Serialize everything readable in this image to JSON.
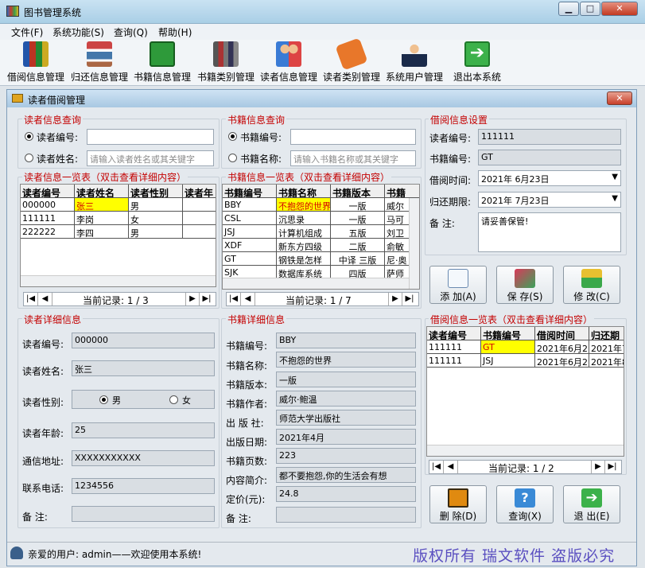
{
  "window": {
    "title": "图书管理系统",
    "min": "▁",
    "max": "□",
    "close": "✕"
  },
  "menu": [
    "文件(F)",
    "系统功能(S)",
    "查询(Q)",
    "帮助(H)"
  ],
  "toolbar": [
    {
      "label": "借阅信息管理",
      "icon": "books-icon"
    },
    {
      "label": "归还信息管理",
      "icon": "bookshelf-icon"
    },
    {
      "label": "书籍信息管理",
      "icon": "green-book-icon"
    },
    {
      "label": "书籍类别管理",
      "icon": "book-stack-icon"
    },
    {
      "label": "读者信息管理",
      "icon": "people-icon"
    },
    {
      "label": "读者类别管理",
      "icon": "orange-book-icon"
    },
    {
      "label": "系统用户管理",
      "icon": "user-icon"
    },
    {
      "label": "退出本系统",
      "icon": "exit-arrow-icon"
    }
  ],
  "subwindow": {
    "title": "读者借阅管理",
    "close": "✕"
  },
  "reader_query": {
    "legend": "读者信息查询",
    "opt_id": "读者编号:",
    "opt_name": "读者姓名:",
    "name_placeholder": "请输入读者姓名或其关键字"
  },
  "book_query": {
    "legend": "书籍信息查询",
    "opt_id": "书籍编号:",
    "opt_name": "书籍名称:",
    "name_placeholder": "请输入书籍名称或其关键字"
  },
  "borrow_settings": {
    "legend": "借阅信息设置",
    "reader_id_label": "读者编号:",
    "reader_id": "111111",
    "book_id_label": "书籍编号:",
    "book_id": "GT",
    "borrow_time_label": "借阅时间:",
    "borrow_time": "2021年 6月23日",
    "return_label": "归还期限:",
    "return_time": "2021年 7月23日",
    "note_label": "备    注:",
    "note": "请妥善保管!"
  },
  "reader_list": {
    "legend": "读者信息一览表（双击查看详细内容）",
    "columns": [
      "读者编号",
      "读者姓名",
      "读者性别",
      "读者年"
    ],
    "rows": [
      [
        "000000",
        "张三",
        "男",
        ""
      ],
      [
        "111111",
        "李岗",
        "女",
        ""
      ],
      [
        "222222",
        "李四",
        "男",
        ""
      ]
    ],
    "record": "当前记录: 1 / 3"
  },
  "book_list": {
    "legend": "书籍信息一览表（双击查看详细内容）",
    "columns": [
      "书籍编号",
      "书籍名称",
      "书籍版本",
      "书籍"
    ],
    "rows": [
      [
        "BBY",
        "不抱怨的世界",
        "一版",
        "威尔"
      ],
      [
        "CSL",
        "沉思录",
        "一版",
        "马可"
      ],
      [
        "JSJ",
        "计算机组成",
        "五版",
        "刘卫"
      ],
      [
        "XDF",
        "新东方四级",
        "二版",
        "俞敏"
      ],
      [
        "GT",
        "钢铁是怎样",
        "中译 三版",
        "尼·奥"
      ],
      [
        "SJK",
        "数据库系统",
        "四版",
        "萨师"
      ]
    ],
    "record": "当前记录: 1 / 7"
  },
  "actions_top": [
    "添 加(A)",
    "保 存(S)",
    "修 改(C)"
  ],
  "reader_detail": {
    "legend": "读者详细信息",
    "id_label": "读者编号:",
    "id": "000000",
    "name_label": "读者姓名:",
    "name": "张三",
    "sex_label": "读者性别:",
    "male": "男",
    "female": "女",
    "age_label": "读者年龄:",
    "age": "25",
    "addr_label": "通信地址:",
    "addr": "XXXXXXXXXXX",
    "phone_label": "联系电话:",
    "phone": "1234556",
    "note_label": "备    注:",
    "note": ""
  },
  "book_detail": {
    "legend": "书籍详细信息",
    "id_label": "书籍编号:",
    "id": "BBY",
    "name_label": "书籍名称:",
    "name": "不抱怨的世界",
    "ver_label": "书籍版本:",
    "ver": "一版",
    "author_label": "书籍作者:",
    "author": "威尔·鲍温",
    "pub_label": "出 版 社:",
    "pub": "师范大学出版社",
    "date_label": "出版日期:",
    "date": "2021年4月",
    "pages_label": "书籍页数:",
    "pages": "223",
    "intro_label": "内容简介:",
    "intro": "都不要抱怨,你的生活会有想",
    "price_label": "定价(元):",
    "price": "24.8",
    "note_label": "备    注:",
    "note": ""
  },
  "borrow_list": {
    "legend": "借阅信息一览表（双击查看详细内容）",
    "columns": [
      "读者编号",
      "书籍编号",
      "借阅时间",
      "归还期"
    ],
    "rows": [
      [
        "111111",
        "GT",
        "2021年6月2",
        "2021年7"
      ],
      [
        "111111",
        "JSJ",
        "2021年6月2",
        "2021年8"
      ]
    ],
    "record": "当前记录: 1 / 2"
  },
  "actions_bottom": [
    "删 除(D)",
    "查询(X)",
    "退 出(E)"
  ],
  "status": {
    "user": "亲爱的用户: admin——欢迎使用本系统!",
    "copyright": "版权所有 瑞文软件 盗版必究"
  }
}
